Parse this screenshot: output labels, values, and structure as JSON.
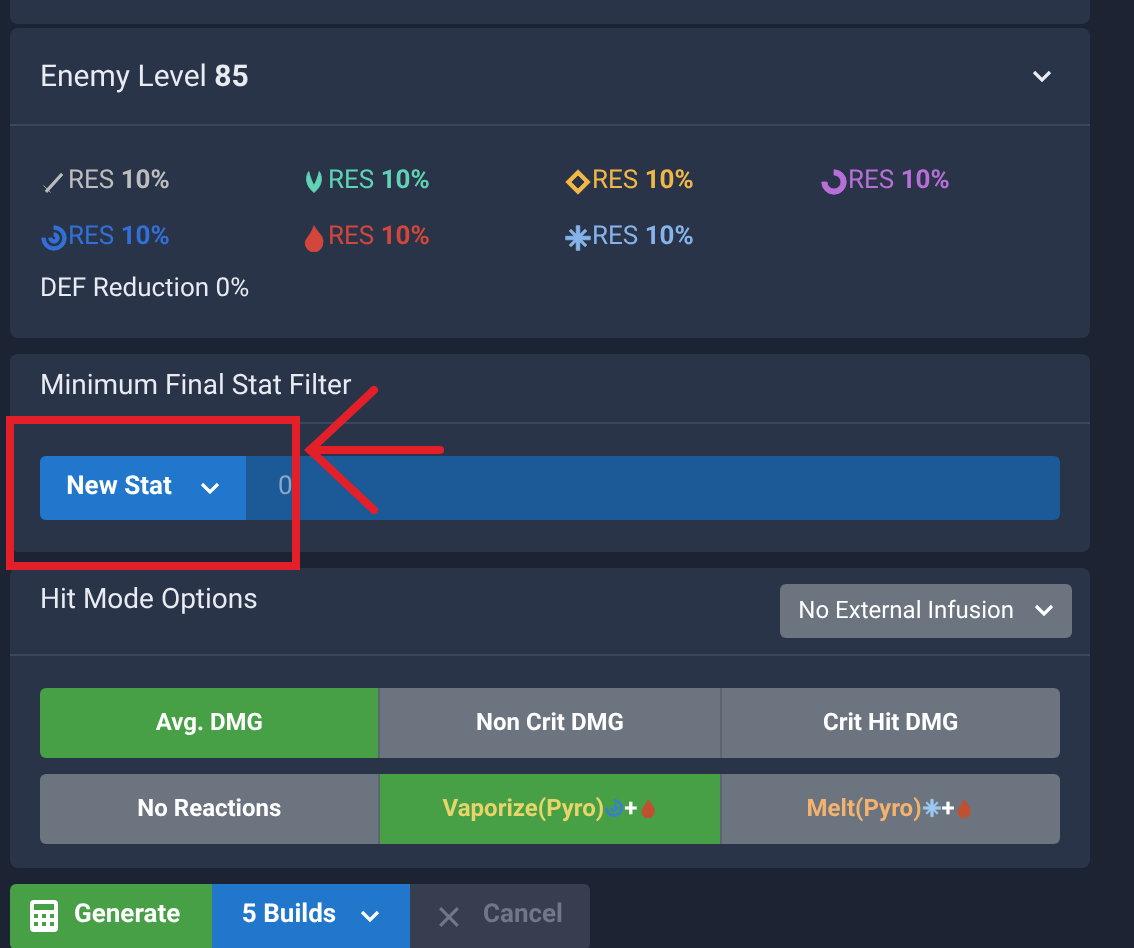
{
  "enemy": {
    "title": "Enemy Level",
    "level": "85",
    "expanded": false,
    "resistances": [
      {
        "kind": "physical",
        "label": "RES",
        "value": "10%",
        "color": "#bdbdbd"
      },
      {
        "kind": "anemo",
        "label": "RES",
        "value": "10%",
        "color": "#5fd3b3"
      },
      {
        "kind": "geo",
        "label": "RES",
        "value": "10%",
        "color": "#f2b845"
      },
      {
        "kind": "electro",
        "label": "RES",
        "value": "10%",
        "color": "#b86fd8"
      },
      {
        "kind": "hydro",
        "label": "RES",
        "value": "10%",
        "color": "#3270d8"
      },
      {
        "kind": "pyro",
        "label": "RES",
        "value": "10%",
        "color": "#d2463b"
      },
      {
        "kind": "cryo",
        "label": "RES",
        "value": "10%",
        "color": "#86b4ea"
      }
    ],
    "def_reduction": "DEF Reduction 0%"
  },
  "stat_filter": {
    "title": "Minimum Final Stat Filter",
    "button": "New Stat",
    "value": "0"
  },
  "hit_mode": {
    "title": "Hit Mode Options",
    "infusion": "No External Infusion",
    "modes": [
      {
        "label": "Avg. DMG",
        "selected": true
      },
      {
        "label": "Non Crit DMG",
        "selected": false
      },
      {
        "label": "Crit Hit DMG",
        "selected": false
      }
    ],
    "reactions": [
      {
        "label": "No Reactions",
        "selected": false,
        "color": "#ffffff"
      },
      {
        "label": "Vaporize(Pyro)",
        "selected": true,
        "color": "#e8d56a",
        "parts": [
          {
            "kind": "hydro"
          },
          {
            "kind": "plus",
            "text": "+"
          },
          {
            "kind": "pyro"
          }
        ]
      },
      {
        "label": "Melt(Pyro)",
        "selected": false,
        "color": "#f3b36c",
        "parts": [
          {
            "kind": "cryo"
          },
          {
            "kind": "plus",
            "text": "+"
          },
          {
            "kind": "pyro"
          }
        ]
      }
    ]
  },
  "actions": {
    "generate": "Generate",
    "builds": "5 Builds",
    "cancel": "Cancel",
    "cancel_disabled": true
  },
  "annotations": {
    "highlight_box": true,
    "arrow": true
  }
}
